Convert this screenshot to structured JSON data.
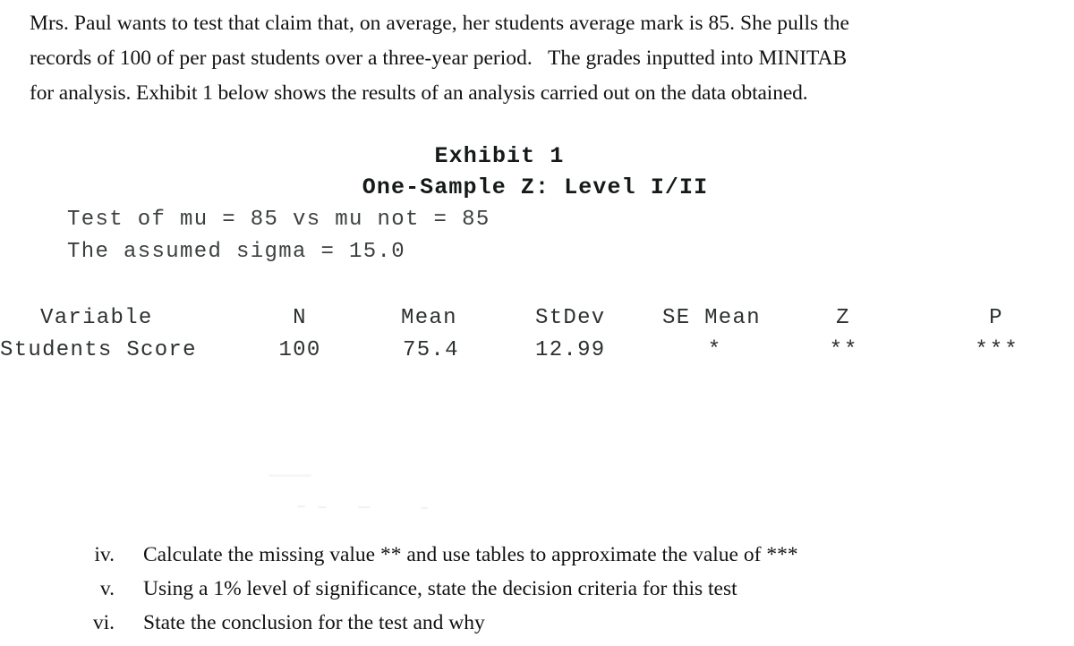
{
  "document": {
    "intro_paragraph": {
      "line1": "Mrs. Paul wants to test that claim that, on average, her students average mark is 85. She pulls the",
      "line2": "records of 100 of per past students over a three-year period.   The grades inputted into MINITAB",
      "line3": "for analysis. Exhibit 1 below shows the results of an analysis carried out on the data obtained."
    },
    "exhibit": {
      "title": "Exhibit 1",
      "procedure_title": "One-Sample Z: Level I/II",
      "test_of": "Test of mu = 85 vs mu not = 85",
      "assumed_sigma": "The assumed sigma = 15.0",
      "table": {
        "headers": {
          "variable": "Variable",
          "n": "N",
          "mean": "Mean",
          "stdev": "StDev",
          "se_mean": "SE Mean",
          "z": "Z",
          "p": "P"
        },
        "rows": [
          {
            "variable": "Students Score",
            "n": "100",
            "mean": "75.4",
            "stdev": "12.99",
            "se_mean": "*",
            "z": "**",
            "p": "***"
          }
        ]
      }
    },
    "questions": [
      {
        "numeral": "iv.",
        "text": "Calculate the missing value ** and use tables to approximate the value of ***"
      },
      {
        "numeral": "v.",
        "text": "Using a 1% level of significance, state the decision criteria for this test"
      },
      {
        "numeral": "vi.",
        "text": "State the conclusion for the test and why"
      }
    ]
  },
  "colors": {
    "page_background": "#ffffff",
    "body_text": "#131212",
    "mono_text": "#2d3132",
    "heading_text": "#16191a"
  }
}
